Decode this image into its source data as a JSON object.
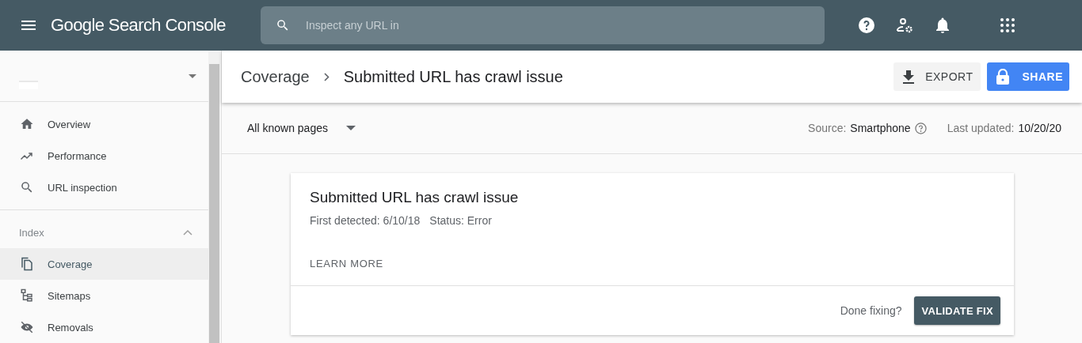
{
  "app_bar": {
    "title": "Google Search Console",
    "search": {
      "placeholder": "Inspect any URL in"
    }
  },
  "sidebar": {
    "items": [
      {
        "label": "Overview",
        "selected": false
      },
      {
        "label": "Performance",
        "selected": false
      },
      {
        "label": "URL inspection",
        "selected": false
      }
    ],
    "sections": [
      {
        "title": "Index",
        "expanded": true,
        "items": [
          {
            "label": "Coverage",
            "selected": true
          },
          {
            "label": "Sitemaps",
            "selected": false
          },
          {
            "label": "Removals",
            "selected": false
          }
        ]
      }
    ]
  },
  "breadcrumb": [
    "Coverage",
    "Submitted URL has crawl issue"
  ],
  "actions": {
    "export": "EXPORT",
    "share": "SHARE"
  },
  "filter": {
    "value": "All known pages",
    "source_label": "Source:",
    "source": "Smartphone",
    "updated_label": "Last updated:",
    "updated": "10/20/20"
  },
  "card": {
    "title": "Submitted URL has crawl issue",
    "first_detected": "First detected: 6/10/18",
    "status": "Status: Error",
    "learn_more": "LEARN MORE",
    "done_fixing": "Done fixing?",
    "validate": "VALIDATE FIX"
  }
}
